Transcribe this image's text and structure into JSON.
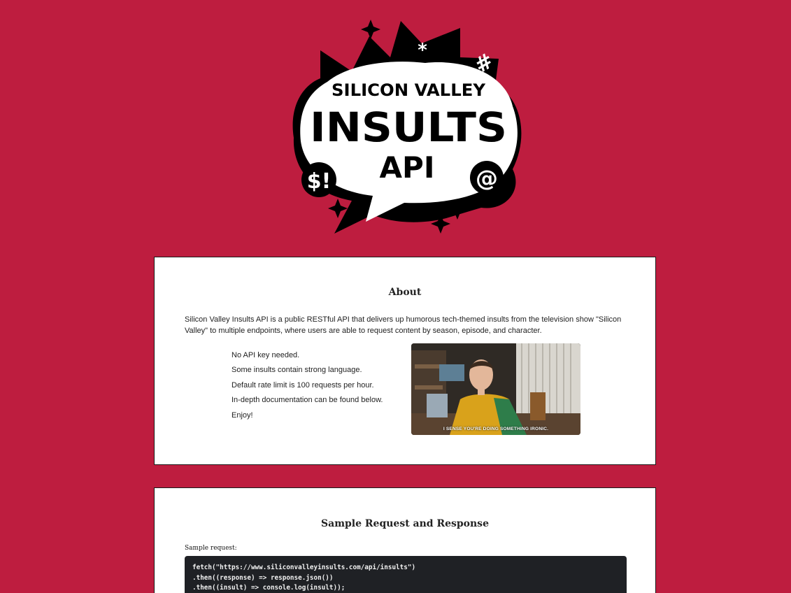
{
  "logo": {
    "line1": "SILICON VALLEY",
    "line2": "INSULTS",
    "line3": "API",
    "symbol_dollar": "$!",
    "symbol_at": "@",
    "symbol_star": "*",
    "symbol_hash": "#",
    "colors": {
      "fill": "#ffffff",
      "outline": "#000000"
    }
  },
  "about": {
    "title": "About",
    "description": "Silicon Valley Insults API is a public RESTful API that delivers up humorous tech-themed insults from the television show \"Silicon Valley\" to multiple endpoints, where users are able to request content by season, episode, and character.",
    "features": [
      "No API key needed.",
      "Some insults contain strong language.",
      "Default rate limit is 100 requests per hour.",
      "In-depth documentation can be found below.",
      "Enjoy!"
    ],
    "gif_caption": "I SENSE YOU'RE DOING SOMETHING IRONIC."
  },
  "sample": {
    "title": "Sample Request and Response",
    "request_label": "Sample request:",
    "code_lines": [
      "fetch(\"https://www.siliconvalleyinsults.com/api/insults\")",
      ".then((response) => response.json())",
      ".then((insult) => console.log(insult));"
    ]
  },
  "colors": {
    "page_background": "#be1d3f",
    "card_background": "#ffffff",
    "code_background": "#1f2125"
  }
}
